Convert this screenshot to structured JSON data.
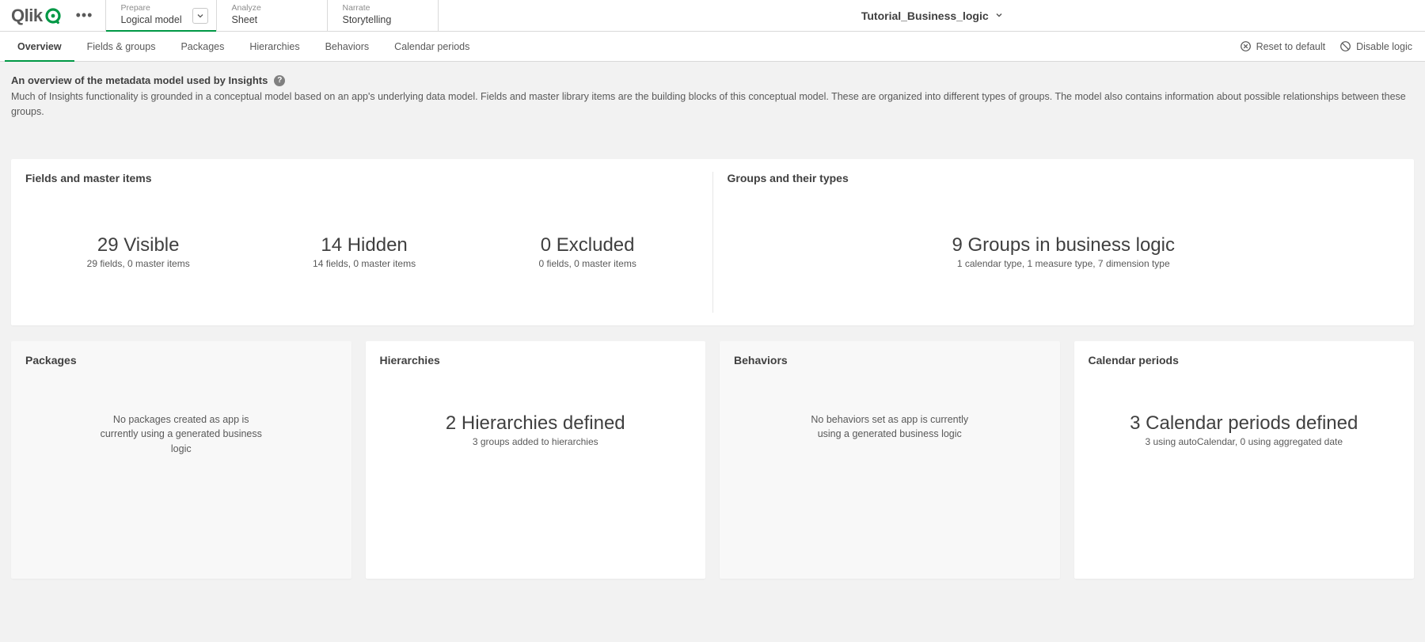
{
  "header": {
    "logo_text": "Qlik",
    "workflow": [
      {
        "label": "Prepare",
        "value": "Logical model",
        "active": true,
        "has_dropdown": true
      },
      {
        "label": "Analyze",
        "value": "Sheet",
        "active": false,
        "has_dropdown": false
      },
      {
        "label": "Narrate",
        "value": "Storytelling",
        "active": false,
        "has_dropdown": false
      }
    ],
    "app_title": "Tutorial_Business_logic"
  },
  "subnav": {
    "tabs": [
      "Overview",
      "Fields & groups",
      "Packages",
      "Hierarchies",
      "Behaviors",
      "Calendar periods"
    ],
    "active_index": 0,
    "actions": {
      "reset": "Reset to default",
      "disable": "Disable logic"
    }
  },
  "overview": {
    "title": "An overview of the metadata model used by Insights",
    "desc": "Much of Insights functionality is grounded in a conceptual model based on an app's underlying data model. Fields and master library items are the building blocks of this conceptual model. These are organized into different types of groups. The model also contains information about possible relationships between these groups."
  },
  "fields_card": {
    "title": "Fields and master items",
    "metrics": [
      {
        "big": "29 Visible",
        "sub": "29 fields, 0 master items"
      },
      {
        "big": "14 Hidden",
        "sub": "14 fields, 0 master items"
      },
      {
        "big": "0 Excluded",
        "sub": "0 fields, 0 master items"
      }
    ]
  },
  "groups_card": {
    "title": "Groups and their types",
    "big": "9 Groups in business logic",
    "sub": "1 calendar type, 1 measure type, 7 dimension type"
  },
  "small_cards": {
    "packages": {
      "title": "Packages",
      "empty_text": "No packages created as app is currently using a generated business logic"
    },
    "hierarchies": {
      "title": "Hierarchies",
      "big": "2 Hierarchies defined",
      "sub": "3 groups added to hierarchies"
    },
    "behaviors": {
      "title": "Behaviors",
      "empty_text": "No behaviors set as app is currently using a generated business logic"
    },
    "calendar": {
      "title": "Calendar periods",
      "big": "3 Calendar periods defined",
      "sub": "3 using autoCalendar, 0 using aggregated date"
    }
  }
}
